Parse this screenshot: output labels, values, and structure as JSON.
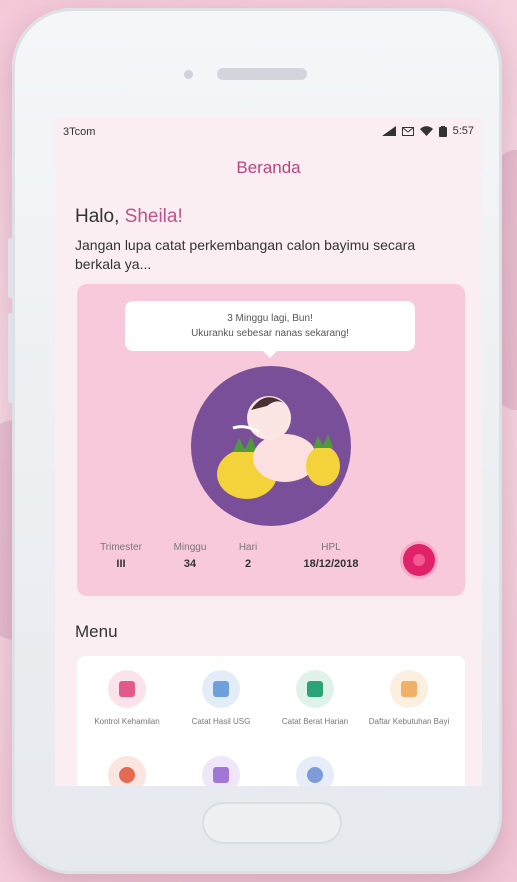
{
  "status_bar": {
    "carrier": "3Tcom",
    "time": "5:57"
  },
  "app": {
    "title": "Beranda"
  },
  "greeting": {
    "hello": "Halo,",
    "name": "Sheila!",
    "message": "Jangan lupa catat perkembangan calon bayimu secara berkala ya..."
  },
  "pregnancy_card": {
    "bubble_line1": "3 Minggu lagi, Bun!",
    "bubble_line2": "Ukuranku sebesar nanas sekarang!",
    "stats": [
      {
        "label": "Trimester",
        "value": "III"
      },
      {
        "label": "Minggu",
        "value": "34"
      },
      {
        "label": "Hari",
        "value": "2"
      },
      {
        "label": "HPL",
        "value": "18/12/2018"
      }
    ]
  },
  "menu": {
    "title": "Menu",
    "items": [
      {
        "label": "Kontrol Kehamilan",
        "icon": "document-icon",
        "color": "#e3598b",
        "bg": "#fbe3ec"
      },
      {
        "label": "Catat Hasil USG",
        "icon": "ultrasound-icon",
        "color": "#6fa0dd",
        "bg": "#e3edf8"
      },
      {
        "label": "Catat Berat Harian",
        "icon": "scale-icon",
        "color": "#2ba377",
        "bg": "#dff3ea"
      },
      {
        "label": "Daftar Kebutuhan Bayi",
        "icon": "basket-icon",
        "color": "#f0b166",
        "bg": "#fcefe0"
      },
      {
        "label": "",
        "icon": "person-icon",
        "color": "#e46a52",
        "bg": "#fbe5e1"
      },
      {
        "label": "",
        "icon": "calendar-icon",
        "color": "#a276d7",
        "bg": "#efe6f8"
      },
      {
        "label": "",
        "icon": "share-icon",
        "color": "#7f9ad9",
        "bg": "#e6ecf8"
      }
    ]
  },
  "colors": {
    "accent": "#b5467e",
    "card_bg": "#f8c9da",
    "fab": "#e0226a",
    "circle": "#7a4f9a"
  }
}
